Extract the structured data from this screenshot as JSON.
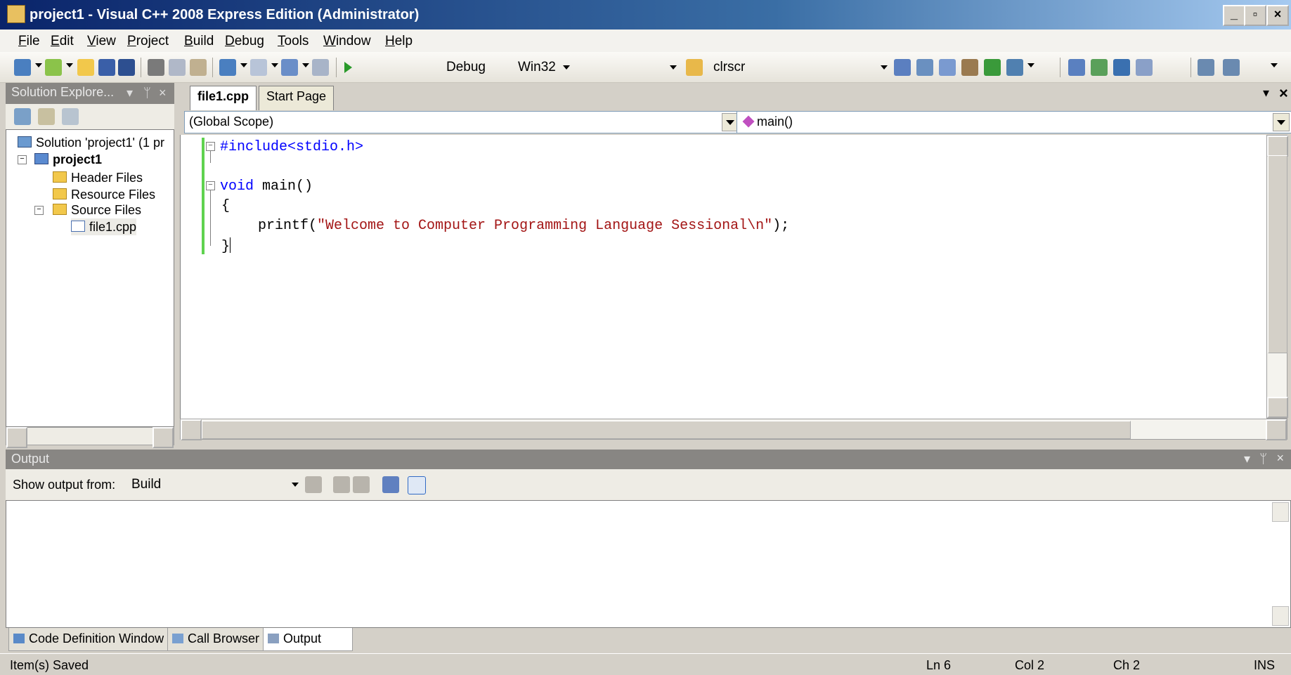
{
  "window": {
    "title": "project1 - Visual C++ 2008 Express Edition (Administrator)"
  },
  "menu": [
    "File",
    "Edit",
    "View",
    "Project",
    "Build",
    "Debug",
    "Tools",
    "Window",
    "Help"
  ],
  "toolbar": {
    "config": "Debug",
    "platform": "Win32",
    "find": "clrscr"
  },
  "solution_explorer": {
    "title": "Solution Explore...",
    "items": {
      "solution": "Solution 'project1' (1 pr",
      "project": "project1",
      "header_files": "Header Files",
      "resource_files": "Resource Files",
      "source_files": "Source Files",
      "file": "file1.cpp"
    }
  },
  "editor": {
    "tabs": [
      "file1.cpp",
      "Start Page"
    ],
    "scope": "(Global Scope)",
    "member": "main()",
    "code": {
      "l1": "#include<stdio.h>",
      "l3_kw": "void",
      "l3_rest": " main()",
      "l4": "{",
      "l5_pre": "printf(",
      "l5_str": "\"Welcome to Computer Programming Language Sessional\\n\"",
      "l5_post": ");",
      "l6": "}"
    }
  },
  "output": {
    "title": "Output",
    "show_label": "Show output from:",
    "show_value": "Build",
    "tabs": [
      "Code Definition Window",
      "Call Browser",
      "Output"
    ]
  },
  "status": {
    "message": "Item(s) Saved",
    "ln": "Ln 6",
    "col": "Col 2",
    "ch": "Ch 2",
    "mode": "INS"
  },
  "colors": {
    "keyword": "#0000ff",
    "string": "#a31515",
    "changed_bar": "#5fd24f"
  }
}
